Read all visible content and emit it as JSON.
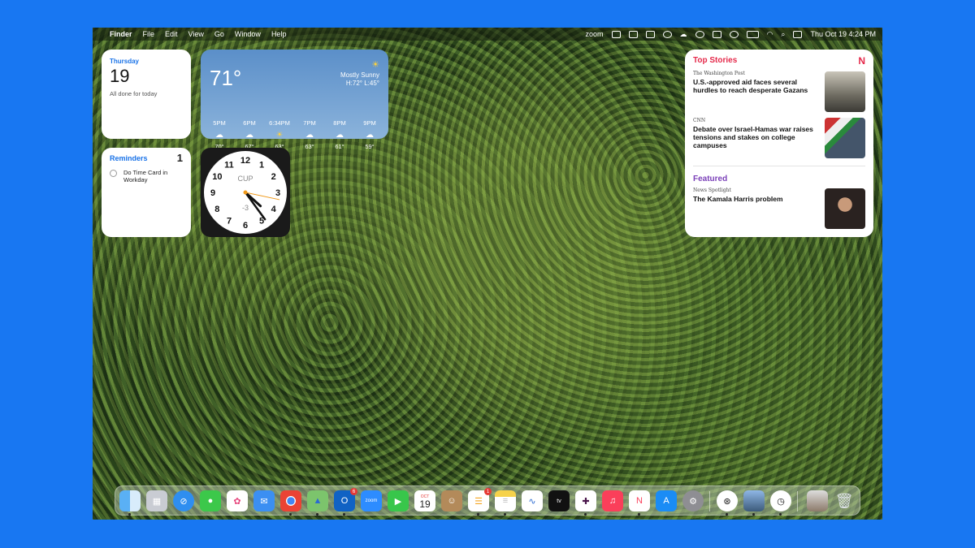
{
  "menubar": {
    "finder": "Finder",
    "menus": [
      "File",
      "Edit",
      "View",
      "Go",
      "Window",
      "Help"
    ],
    "zoom": "zoom",
    "clock": "Thu Oct 19  4:24 PM"
  },
  "calendar": {
    "weekday": "Thursday",
    "day": "19",
    "status": "All done for today"
  },
  "weather": {
    "temp": "71°",
    "condition": "Mostly Sunny",
    "hilo": "H:72° L:45°",
    "hours": [
      {
        "time": "5PM",
        "icon": "☁",
        "temp": "70°"
      },
      {
        "time": "6PM",
        "icon": "☁",
        "temp": "67°"
      },
      {
        "time": "6:34PM",
        "icon": "☀",
        "temp": "63°"
      },
      {
        "time": "7PM",
        "icon": "☁",
        "temp": "63°"
      },
      {
        "time": "8PM",
        "icon": "☁",
        "temp": "61°"
      },
      {
        "time": "9PM",
        "icon": "☁",
        "temp": "59°"
      }
    ]
  },
  "reminders": {
    "title": "Reminders",
    "count": "1",
    "item": "Do Time Card in Workday"
  },
  "clock_widget": {
    "city": "CUP",
    "offset": "-3",
    "hour": 4,
    "minute": 24,
    "second": 17,
    "numerals": [
      "12",
      "1",
      "2",
      "3",
      "4",
      "5",
      "6",
      "7",
      "8",
      "9",
      "10",
      "11"
    ]
  },
  "news": {
    "header": "Top Stories",
    "stories": [
      {
        "source": "The Washington Post",
        "headline": "U.S.-approved aid faces several hurdles to reach desperate Gazans"
      },
      {
        "source": "CNN",
        "headline": "Debate over Israel-Hamas war raises tensions and stakes on college campuses"
      }
    ],
    "featured_header": "Featured",
    "featured": {
      "source": "News Spotlight",
      "headline": "The Kamala Harris problem"
    }
  },
  "dock": {
    "calendar_month": "OCT",
    "calendar_day": "19",
    "outlook_badge": "6",
    "reminders_badge": "1",
    "zoom_label": "zoom",
    "tv_label": "tv"
  },
  "colors": {
    "accent": "#1a73e8",
    "news_red": "#e5294a",
    "featured_purple": "#7a3fb8",
    "page_bg": "#1877f2"
  }
}
